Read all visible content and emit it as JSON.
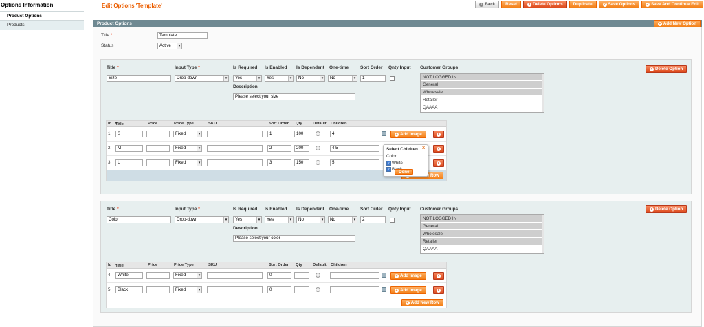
{
  "sidebar": {
    "title": "Options Information",
    "tabs": [
      {
        "label": "Product Options",
        "active": true
      },
      {
        "label": "Products",
        "active": false
      }
    ]
  },
  "header": {
    "title": "Edit Options 'Template'",
    "buttons": {
      "back": "Back",
      "reset": "Reset",
      "delete": "Delete Options",
      "duplicate": "Duplicate",
      "save": "Save Options",
      "save_continue": "Save And Continue Edit"
    }
  },
  "section": {
    "title": "Product Options",
    "add_option": "Add New Option",
    "title_label": "Title",
    "title_value": "Template",
    "status_label": "Status",
    "status_value": "Active"
  },
  "labels": {
    "title": "Title",
    "input_type": "Input Type",
    "is_required": "Is Required",
    "is_enabled": "Is Enabled",
    "is_dependent": "Is Dependent",
    "one_time": "One-time",
    "sort_order": "Sort Order",
    "qnty_input": "Qnty Input",
    "customer_groups": "Customer Groups",
    "description": "Description",
    "delete_option": "Delete Option",
    "add_image": "Add Image",
    "add_new_row": "Add New Row"
  },
  "table_headers": {
    "id": "Id",
    "title": "Title",
    "price": "Price",
    "price_type": "Price Type",
    "sku": "SKU",
    "sort_order": "Sort Order",
    "qty": "Qty",
    "default": "Default",
    "children": "Children"
  },
  "customer_groups": [
    "NOT LOGGED IN",
    "General",
    "Wholesale",
    "Retailer",
    "QAAAA"
  ],
  "options": [
    {
      "title": "Size",
      "input_type": "Drop-down",
      "is_required": "Yes",
      "is_enabled": "Yes",
      "is_dependent": "No",
      "one_time": "No",
      "sort_order": "1",
      "description": "Please select your size",
      "rows": [
        {
          "id": "1",
          "title": "S",
          "price_type": "Fixed",
          "sort": "1",
          "qty": "100",
          "children": "4"
        },
        {
          "id": "2",
          "title": "M",
          "price_type": "Fixed",
          "sort": "2",
          "qty": "200",
          "children": "4,5"
        },
        {
          "id": "3",
          "title": "L",
          "price_type": "Fixed",
          "sort": "3",
          "qty": "150",
          "children": "5"
        }
      ]
    },
    {
      "title": "Color",
      "input_type": "Drop-down",
      "is_required": "Yes",
      "is_enabled": "Yes",
      "is_dependent": "No",
      "one_time": "No",
      "sort_order": "2",
      "description": "Please select your color",
      "rows": [
        {
          "id": "4",
          "title": "White",
          "price_type": "Fixed",
          "sort": "0",
          "qty": "",
          "children": ""
        },
        {
          "id": "5",
          "title": "Black",
          "price_type": "Fixed",
          "sort": "0",
          "qty": "",
          "children": ""
        }
      ]
    }
  ],
  "popup": {
    "title": "Select Children",
    "close": "x",
    "group": "Color",
    "options": [
      "White",
      "Black"
    ],
    "done": "Done"
  }
}
